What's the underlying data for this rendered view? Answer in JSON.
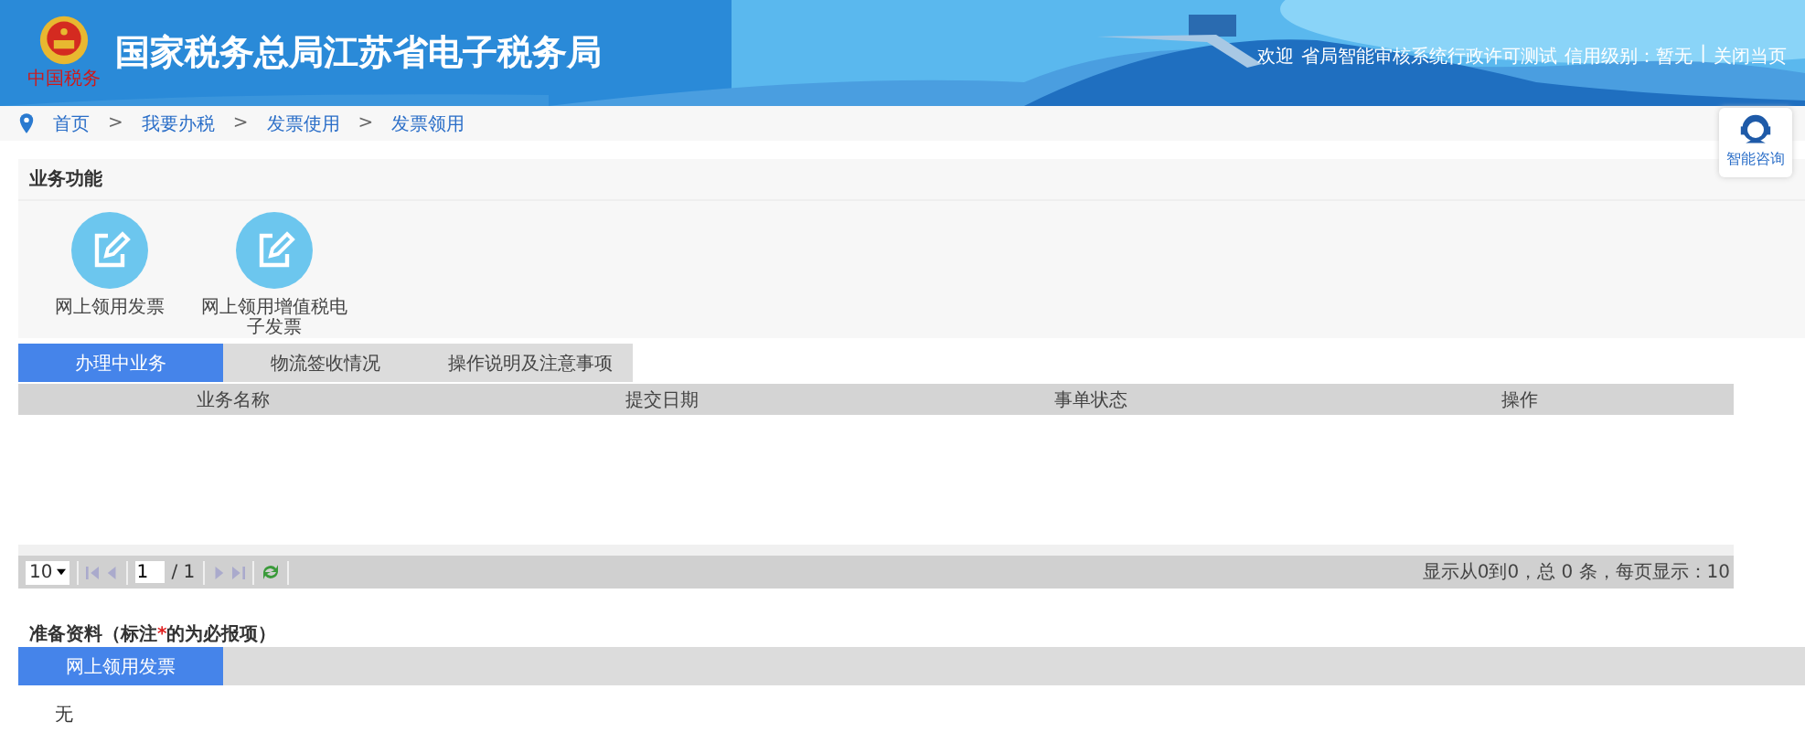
{
  "header": {
    "logo_caption": "中国税务",
    "title": "国家税务总局江苏省电子税务局",
    "welcome": "欢迎",
    "user": "省局智能审核系统行政许可测试",
    "credit": "信用级别：暂无",
    "separator": "|",
    "close": "关闭当页"
  },
  "breadcrumb": [
    "首页",
    ">",
    "我要办税",
    ">",
    "发票使用",
    ">",
    "发票领用"
  ],
  "consult": {
    "label": "智能咨询"
  },
  "functions": {
    "title": "业务功能",
    "items": [
      {
        "label": "网上领用发票"
      },
      {
        "label": "网上领用增值税电子发票"
      }
    ]
  },
  "tabs": [
    {
      "label": "办理中业务",
      "selected": true
    },
    {
      "label": "物流签收情况",
      "selected": false
    },
    {
      "label": "操作说明及注意事项",
      "selected": false
    }
  ],
  "table": {
    "columns": [
      "业务名称",
      "提交日期",
      "事单状态",
      "操作"
    ]
  },
  "pager": {
    "page_size": "10",
    "page": "1",
    "total_pages": "/ 1",
    "summary": "显示从0到0，总 0 条，每页显示：10"
  },
  "materials": {
    "title_start": "准备资料（标注",
    "required_mark": "*",
    "title_end": "的为必报项）",
    "tabs": [
      {
        "label": "网上领用发票",
        "selected": true
      }
    ],
    "content": "无"
  }
}
